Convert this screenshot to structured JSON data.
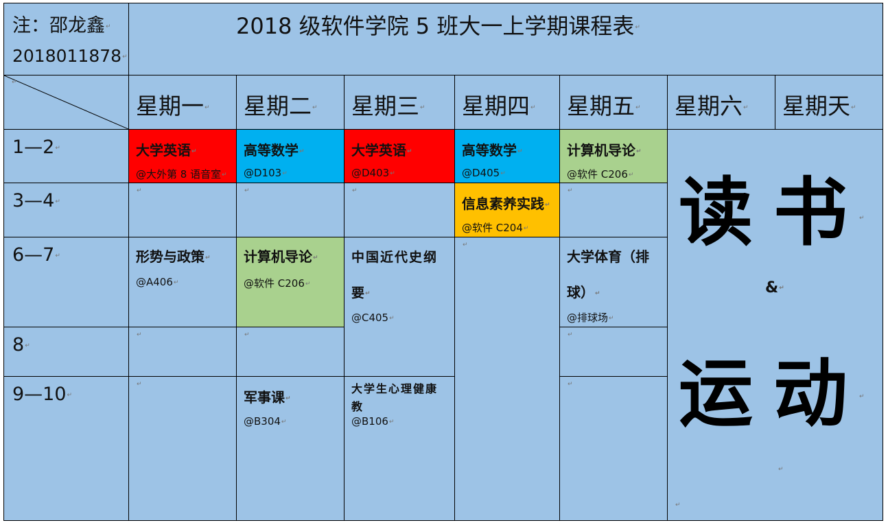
{
  "header": {
    "note_name": "注：邵龙鑫",
    "student_id": "2018011878",
    "title": "2018 级软件学院 5 班大一上学期课程表"
  },
  "colors": {
    "cell_bg": "#9dc3e6",
    "english": "#ff0000",
    "math": "#00b0f0",
    "intro": "#a9d18e",
    "info": "#ffc000"
  },
  "days": [
    "星期一",
    "星期二",
    "星期三",
    "星期四",
    "星期五",
    "星期六",
    "星期天"
  ],
  "periods": [
    "1—2",
    "3—4",
    "6—7",
    "8",
    "9—10"
  ],
  "courses": {
    "mon_12": {
      "name": "大学英语",
      "room": "@大外第 8 语音室"
    },
    "tue_12": {
      "name": "高等数学",
      "room": "@D103"
    },
    "wed_12": {
      "name": "大学英语",
      "room": "@D403"
    },
    "thu_12": {
      "name": "高等数学",
      "room": "@D405"
    },
    "fri_12": {
      "name": "计算机导论",
      "room": "@软件 C206"
    },
    "thu_34": {
      "name": "信息素养实践",
      "room": "@软件 C204"
    },
    "mon_67": {
      "name": "形势与政策",
      "room": "@A406"
    },
    "tue_67": {
      "name": "计算机导论",
      "room": "@软件 C206"
    },
    "wed_67": {
      "name_line1": "中国近代史纲",
      "name_line2": "要",
      "room": "@C405"
    },
    "fri_67": {
      "name_line1": "大学体育（排",
      "name_line2": "球）",
      "room": "@排球场"
    },
    "tue_910": {
      "name": "军事课",
      "room": "@B304"
    },
    "wed_910": {
      "name_line1": "大学生心理健康",
      "name_line2": "教",
      "room": "@B106"
    }
  },
  "weekend": {
    "line1": "读书",
    "amp": "&",
    "line2": "运动"
  },
  "paragraph_mark": "↵"
}
